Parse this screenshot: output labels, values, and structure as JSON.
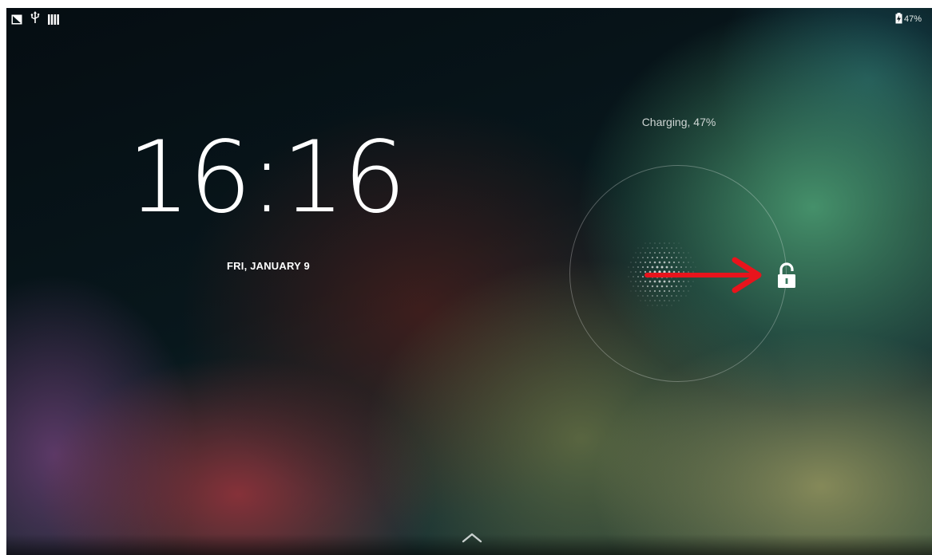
{
  "status_bar": {
    "left_icons": [
      "screenshot-icon",
      "usb-icon",
      "signal-icon"
    ],
    "battery_icon": "battery-charging-icon",
    "battery_text": "47%"
  },
  "lockscreen": {
    "time": "16:16",
    "date": "FRI, JANUARY 9",
    "charging_status": "Charging, 47%",
    "unlock_target_icon": "unlock-icon",
    "swipe_hint_icon": "red-arrow-icon",
    "bottom_hint_icon": "chevron-up-icon"
  },
  "colors": {
    "accent_arrow": "#e8141c",
    "text": "#ffffff"
  }
}
